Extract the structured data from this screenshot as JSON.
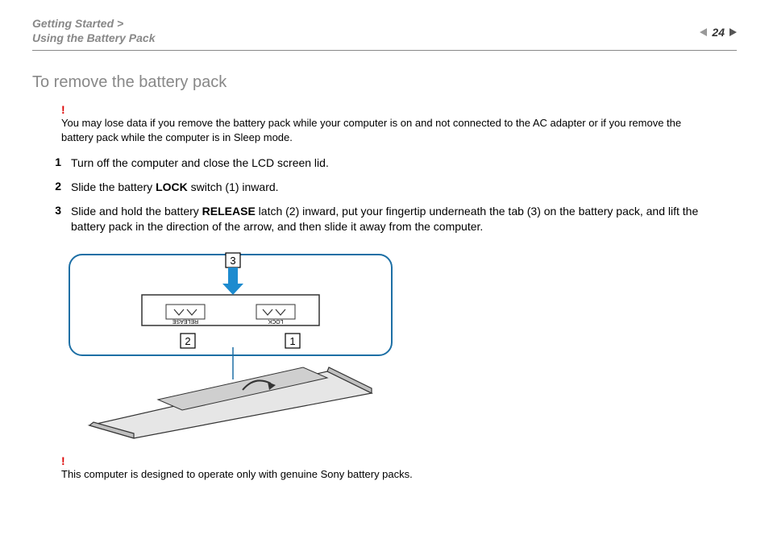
{
  "header": {
    "breadcrumb_line1": "Getting Started >",
    "breadcrumb_line2": "Using the Battery Pack",
    "page_number": "24"
  },
  "title": "To remove the battery pack",
  "warnings": {
    "mark": "!",
    "top": "You may lose data if you remove the battery pack while your computer is on and not connected to the AC adapter or if you remove the battery pack while the computer is in Sleep mode.",
    "bottom": "This computer is designed to operate only with genuine Sony battery packs."
  },
  "steps": [
    {
      "num": "1",
      "pre": "Turn off the computer and close the LCD screen lid.",
      "bold": "",
      "post": ""
    },
    {
      "num": "2",
      "pre": "Slide the battery ",
      "bold": "LOCK",
      "post": " switch (1) inward."
    },
    {
      "num": "3",
      "pre": "Slide and hold the battery ",
      "bold": "RELEASE",
      "post": " latch (2) inward, put your fingertip underneath the tab (3) on the battery pack, and lift the battery pack in the direction of the arrow, and then slide it away from the computer."
    }
  ],
  "diagram": {
    "callout_1": "1",
    "callout_2": "2",
    "callout_3": "3",
    "label_release": "RELEASE",
    "label_lock": "LOCK"
  }
}
